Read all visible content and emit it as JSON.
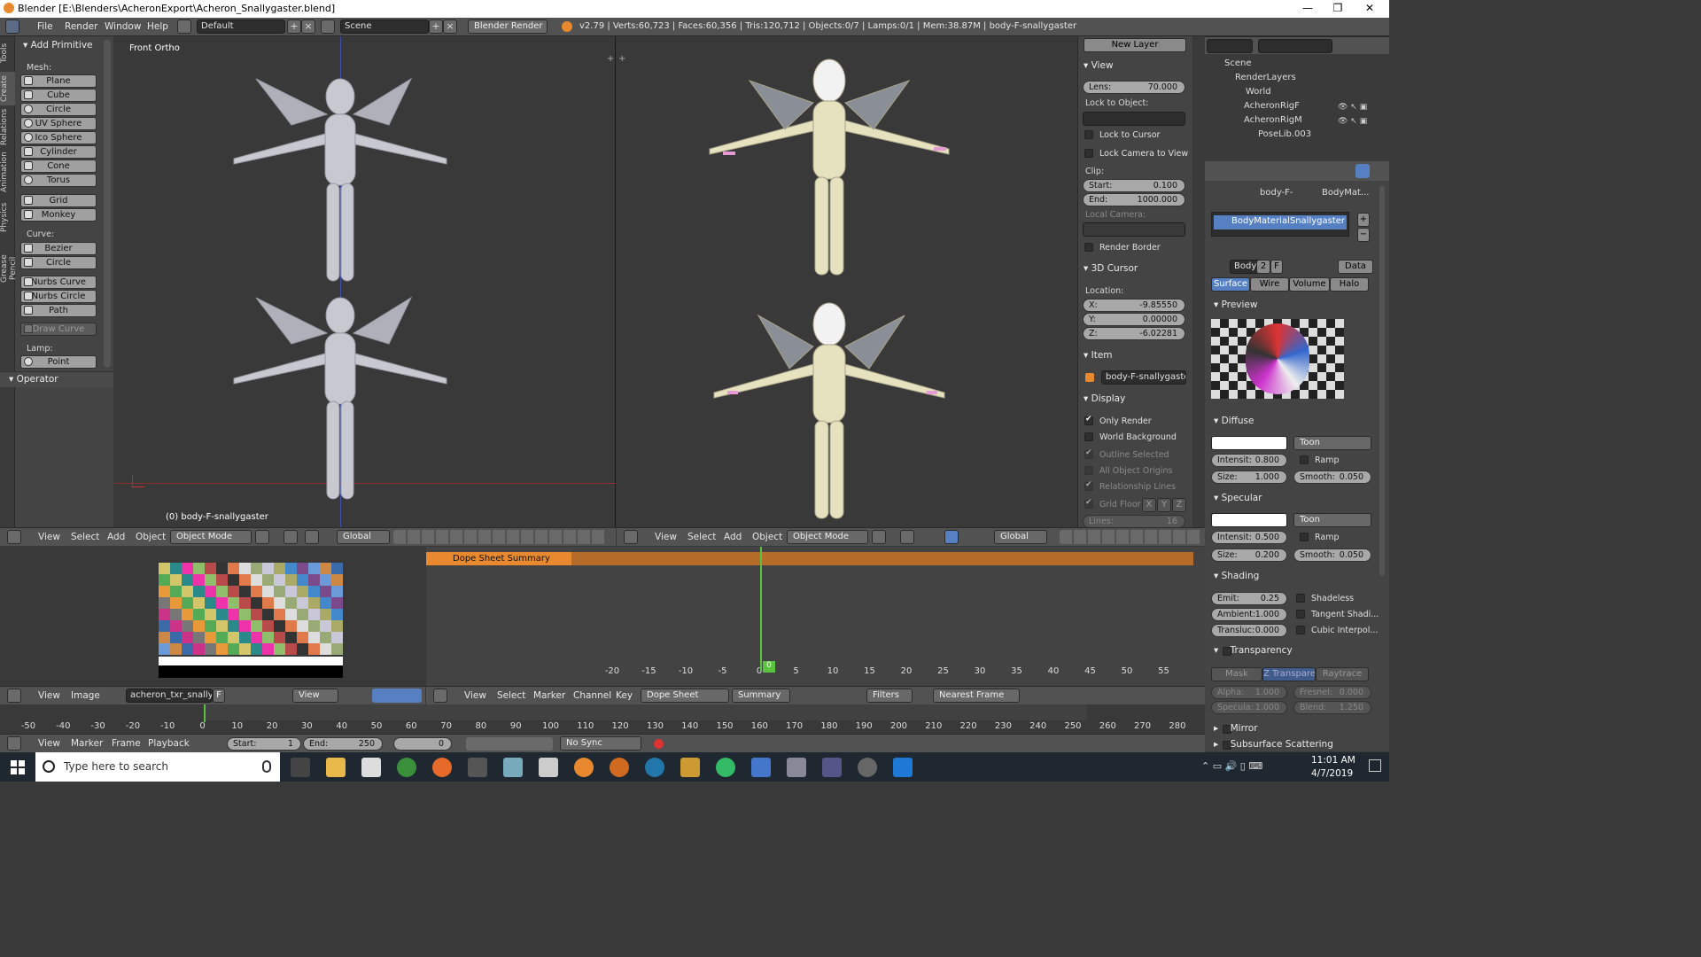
{
  "window": {
    "title": "Blender [E:\\Blenders\\AcheronExport\\Acheron_Snallygaster.blend]",
    "min": "—",
    "max": "❐",
    "close": "✕"
  },
  "info": {
    "menus": [
      "File",
      "Render",
      "Window",
      "Help"
    ],
    "layout": "Default",
    "scene": "Scene",
    "engine": "Blender Render",
    "stats": "v2.79 | Verts:60,723 | Faces:60,356 | Tris:120,712 | Objects:0/7 | Lamps:0/1 | Mem:38.87M | body-F-snallygaster"
  },
  "toolshelf": {
    "tabs": [
      "Tools",
      "Create",
      "Relations",
      "Animation",
      "Physics",
      "Grease Pencil"
    ],
    "header": "Add Primitive",
    "mesh_label": "Mesh:",
    "mesh": [
      "Plane",
      "Cube",
      "Circle",
      "UV Sphere",
      "Ico Sphere",
      "Cylinder",
      "Cone",
      "Torus",
      "Grid",
      "Monkey"
    ],
    "curve_label": "Curve:",
    "curve": [
      "Bezier",
      "Circle",
      "Nurbs Curve",
      "Nurbs Circle",
      "Path",
      "Draw Curve"
    ],
    "lamp_label": "Lamp:",
    "lamp": [
      "Point"
    ],
    "operator": "Operator"
  },
  "viewport1": {
    "label": "Front Ortho",
    "object": "(0) body-F-snallygaster",
    "menus": [
      "View",
      "Select",
      "Add",
      "Object"
    ],
    "mode": "Object Mode",
    "orient": "Global"
  },
  "viewport2": {
    "menus": [
      "View",
      "Select",
      "Add",
      "Object"
    ],
    "mode": "Object Mode",
    "orient": "Global"
  },
  "npanel": {
    "new_layer": "New Layer",
    "view": "View",
    "lens_label": "Lens:",
    "lens": "70.000",
    "lock_object": "Lock to Object:",
    "lock_cursor": "Lock to Cursor",
    "lock_camera": "Lock Camera to View",
    "clip": "Clip:",
    "start_label": "Start:",
    "start": "0.100",
    "end_label": "End:",
    "end": "1000.000",
    "local_camera": "Local Camera:",
    "render_border": "Render Border",
    "cursor": "3D Cursor",
    "location": "Location:",
    "x_label": "X:",
    "x": "-9.85550",
    "y_label": "Y:",
    "y": "0.00000",
    "z_label": "Z:",
    "z": "-6.02281",
    "item": "Item",
    "item_name": "body-F-snallygaster",
    "display": "Display",
    "only_render": "Only Render",
    "world_bg": "World Background",
    "outline": "Outline Selected",
    "all_origins": "All Object Origins",
    "rel_lines": "Relationship Lines",
    "grid_floor": "Grid Floor",
    "gx": "X",
    "gy": "Y",
    "gz": "Z",
    "lines_label": "Lines:",
    "lines": "16"
  },
  "outliner": {
    "items": [
      "Scene",
      "RenderLayers",
      "World",
      "AcheronRigF",
      "AcheronRigM",
      "PoseLib.003"
    ]
  },
  "props": {
    "breadcrumb1": "body-F-",
    "breadcrumb2": "BodyMat...",
    "material": "BodyMaterialSnallygaster",
    "mat_short": "Body",
    "users": "2",
    "fake": "F",
    "data": "Data",
    "tabs": [
      "Surface",
      "Wire",
      "Volume",
      "Halo"
    ],
    "preview": "Preview",
    "diffuse": "Diffuse",
    "diffuse_shader": "Toon",
    "intensity_label": "Intensit:",
    "diffuse_intensity": "0.800",
    "ramp": "Ramp",
    "size_label": "Size:",
    "diffuse_size": "1.000",
    "smooth_label": "Smooth:",
    "diffuse_smooth": "0.050",
    "specular": "Specular",
    "spec_shader": "Toon",
    "spec_int_label": "Intensit:",
    "spec_intensity": "0.500",
    "spec_size": "0.200",
    "spec_smooth": "0.050",
    "shading": "Shading",
    "emit_label": "Emit:",
    "emit": "0.25",
    "shadeless": "Shadeless",
    "ambient_label": "Ambient:",
    "ambient": "1.000",
    "tangent": "Tangent Shadi...",
    "transluc_label": "Transluc:",
    "transluc": "0.000",
    "cubic": "Cubic Interpol...",
    "transparency": "Transparency",
    "t_tabs": [
      "Mask",
      "Z Transpare...",
      "Raytrace"
    ],
    "alpha_label": "Alpha:",
    "alpha": "1.000",
    "fresnel_label": "Fresnel:",
    "fresnel": "0.000",
    "specula_label": "Specula:",
    "specula": "1.000",
    "blend_label": "Blend:",
    "blend": "1.250",
    "mirror": "Mirror",
    "sss": "Subsurface Scattering"
  },
  "uv": {
    "menus": [
      "View",
      "Image"
    ],
    "image": "acheron_txr_snallyg...",
    "f": "F",
    "view": "View"
  },
  "dope": {
    "summary_row": "Dope Sheet Summary",
    "menus": [
      "View",
      "Select",
      "Marker",
      "Channel",
      "Key"
    ],
    "mode": "Dope Sheet",
    "summary": "Summary",
    "filters": "Filters",
    "snap": "Nearest Frame",
    "frame": "0",
    "ticks": [
      "-20",
      "-15",
      "-10",
      "-5",
      "0",
      "5",
      "10",
      "15",
      "20",
      "25",
      "30",
      "35",
      "40",
      "45",
      "50",
      "55"
    ]
  },
  "timeline": {
    "ticks": [
      "-50",
      "-40",
      "-30",
      "-20",
      "-10",
      "0",
      "10",
      "20",
      "30",
      "40",
      "50",
      "60",
      "70",
      "80",
      "90",
      "100",
      "110",
      "120",
      "130",
      "140",
      "150",
      "160",
      "170",
      "180",
      "190",
      "200",
      "210",
      "220",
      "230",
      "240",
      "250",
      "260",
      "270",
      "280"
    ],
    "menus": [
      "View",
      "Marker",
      "Frame",
      "Playback"
    ],
    "start_label": "Start:",
    "start": "1",
    "end_label": "End:",
    "end": "250",
    "current": "0",
    "sync": "No Sync"
  },
  "taskbar": {
    "search": "Type here to search",
    "time": "11:01 AM",
    "date": "4/7/2019"
  },
  "colors": {
    "accent": "#5680c2",
    "orange": "#e8892f",
    "green": "#59c23e"
  }
}
